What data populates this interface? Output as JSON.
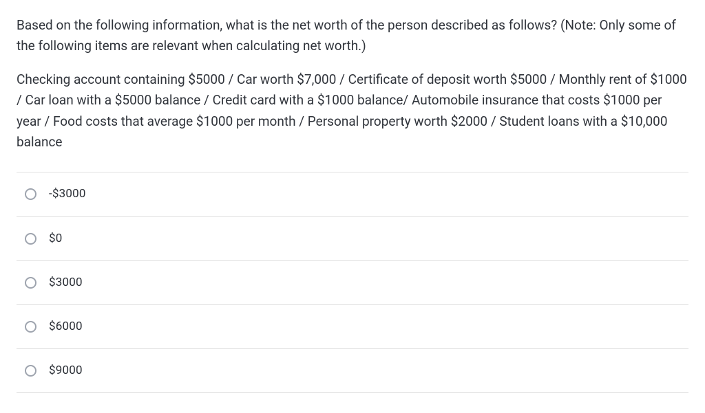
{
  "question": {
    "stem": "Based on the following information, what is the net worth of the person described as follows?  (Note:  Only some of the following items are relevant when calculating net worth.)",
    "detail": "Checking account containing $5000 / Car worth $7,000 / Certificate of deposit worth $5000 / Monthly rent of $1000 / Car loan with a $5000 balance / Credit card with a $1000 balance/ Automobile insurance that costs $1000 per year / Food costs that average $1000 per month / Personal property worth $2000 / Student loans with a $10,000 balance"
  },
  "options": [
    {
      "label": "-$3000"
    },
    {
      "label": "$0"
    },
    {
      "label": "$3000"
    },
    {
      "label": "$6000"
    },
    {
      "label": "$9000"
    }
  ]
}
